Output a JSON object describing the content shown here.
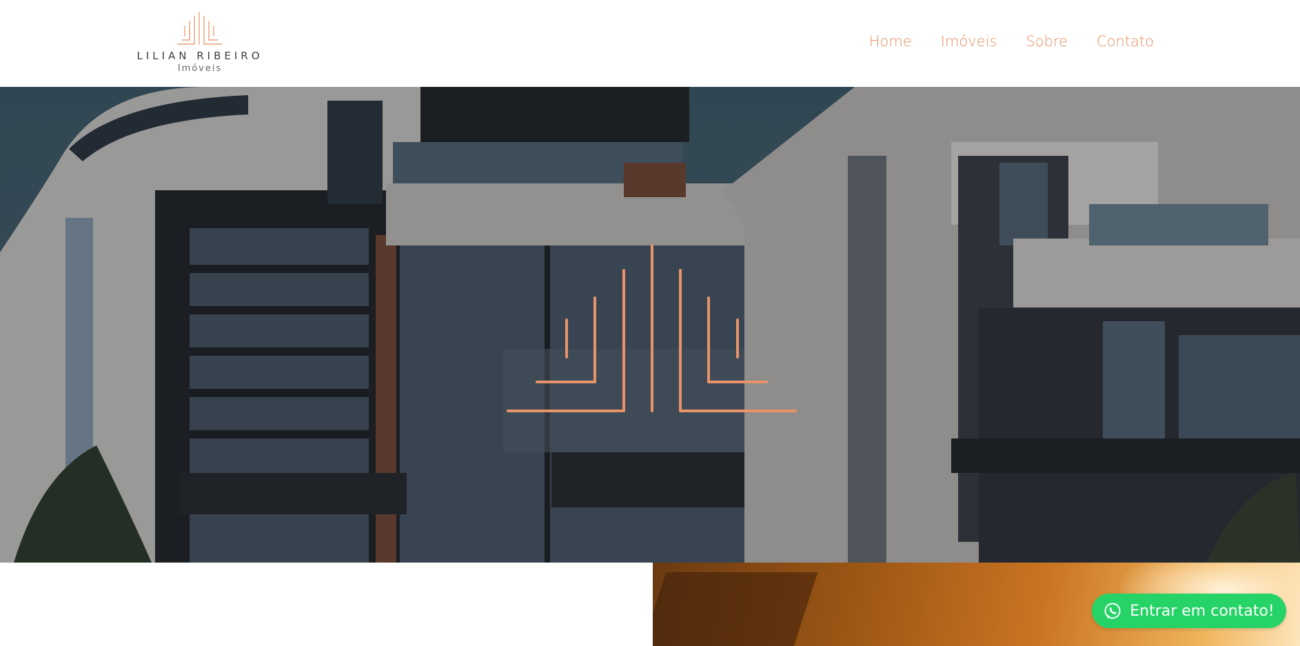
{
  "brand": {
    "name": "LILIAN RIBEIRO",
    "tagline": "Imóveis"
  },
  "nav": {
    "items": [
      {
        "label": "Home"
      },
      {
        "label": "Imóveis"
      },
      {
        "label": "Sobre"
      },
      {
        "label": "Contato"
      }
    ]
  },
  "hero": {
    "background": "modern-house-photo",
    "mark": "lr-logo-mark"
  },
  "lower_banner": {
    "background": "sunset-photo"
  },
  "whatsapp": {
    "label": "Entrar em contato!",
    "icon": "whatsapp-icon"
  },
  "colors": {
    "accent": "#e38f62",
    "whatsapp": "#25d366",
    "text_dark": "#3a3d44"
  }
}
